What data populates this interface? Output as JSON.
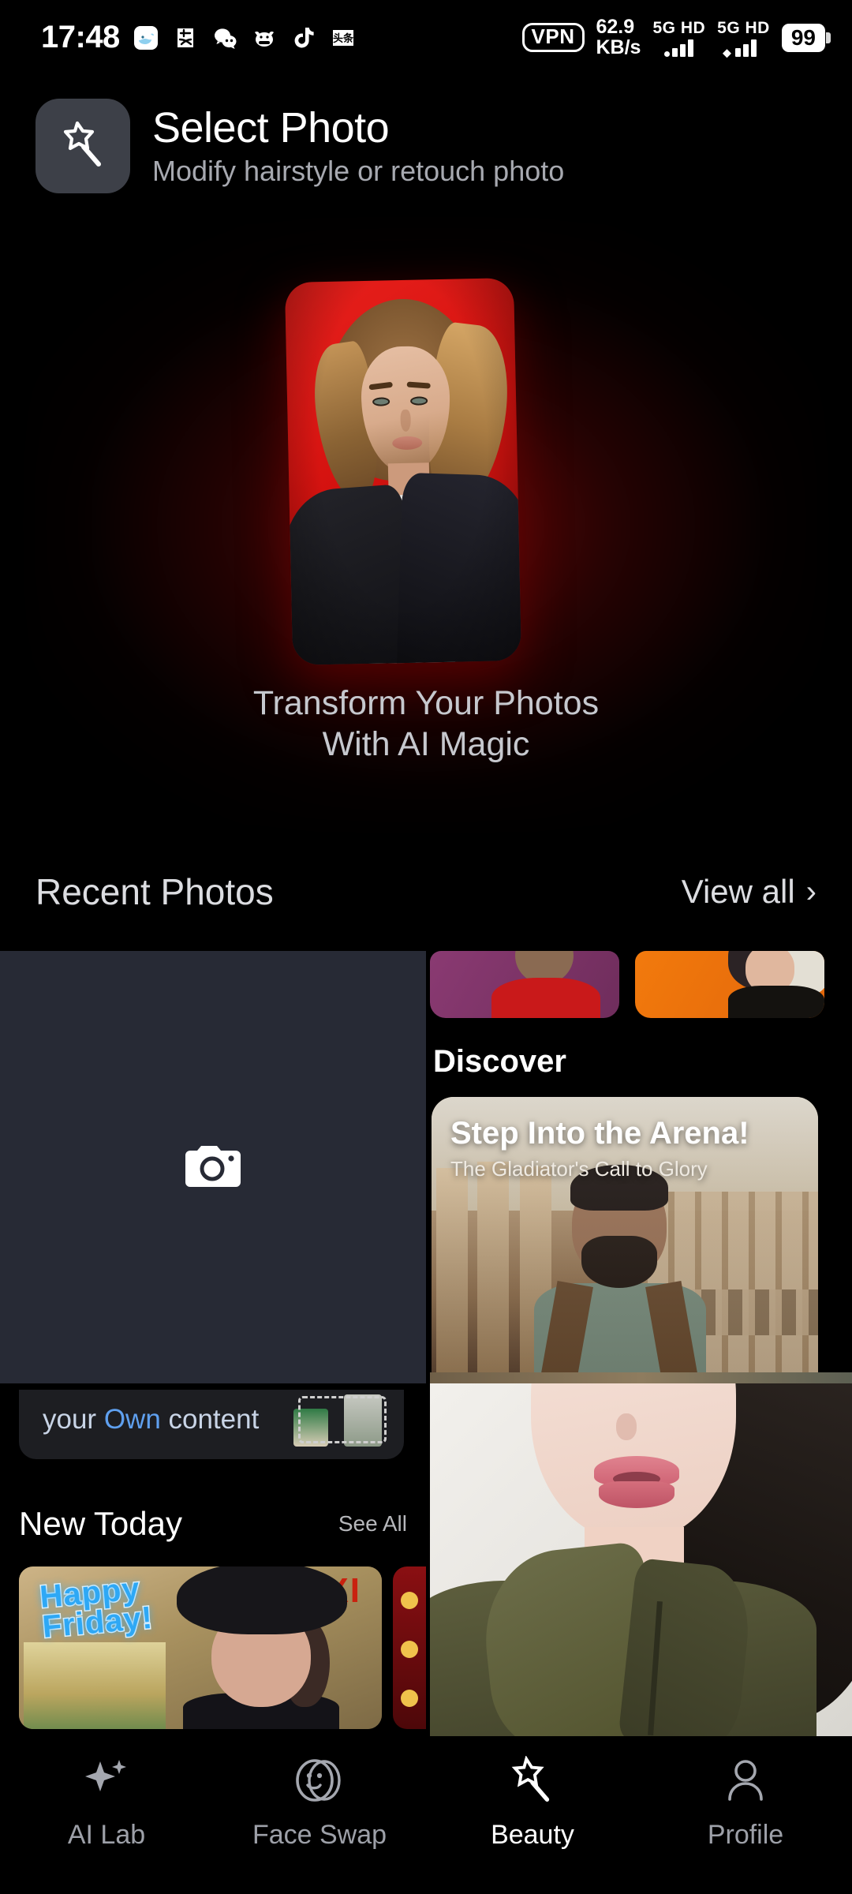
{
  "status_bar": {
    "time": "17:48",
    "tray_icons": [
      "whale-icon",
      "alipay-icon",
      "wechat-icon",
      "bull-icon",
      "tiktok-icon",
      "toutiao-icon"
    ],
    "vpn_label": "VPN",
    "net_speed_value": "62.9",
    "net_speed_unit": "KB/s",
    "sim1_label": "5G HD",
    "sim2_label": "5G HD",
    "battery_level": "99"
  },
  "header": {
    "icon": "magic-wand-icon",
    "title": "Select Photo",
    "subtitle": "Modify hairstyle or retouch photo",
    "icon_bg": "#3d4048"
  },
  "hero": {
    "caption_line1": "Transform Your Photos",
    "caption_line2": "With AI Magic",
    "card_bg_color": "#d4120f",
    "glow_color": "#aa0c0c",
    "caption_color": "#c6c8ce"
  },
  "recent_photos": {
    "title": "Recent Photos",
    "view_all_label": "View all",
    "chevron": "chevron-right-icon",
    "camera_tile": {
      "icon": "camera-icon",
      "bg_color": "#272a35"
    },
    "thumbnails": [
      {
        "name": "child-purple-thumb",
        "bg_color": "#6f2d5c"
      },
      {
        "name": "portrait-orange-thumb",
        "bg_color": "#e2660a"
      }
    ]
  },
  "discover": {
    "title": "Discover",
    "card": {
      "headline": "Step Into the Arena!",
      "subhead": "The Gladiator's Call to Glory"
    }
  },
  "own_content_band": {
    "text_prefix": "your ",
    "text_highlight": "Own",
    "text_suffix": " content",
    "highlight_color": "#5fa0ef",
    "bg_color": "#1d1e22"
  },
  "new_today": {
    "title": "New Today",
    "see_all_label": "See All",
    "cards": [
      {
        "name": "happy-friday-card",
        "sticker_line1": "Happy",
        "sticker_line2": "Friday!",
        "exit_sign": "EXI",
        "sticker_color": "#2ea8f5"
      },
      {
        "name": "red-stage-card",
        "sticker_line1": "",
        "sticker_line2": ""
      }
    ]
  },
  "bottom_nav": {
    "items": [
      {
        "label": "AI Lab",
        "icon": "sparkle-icon",
        "active": false
      },
      {
        "label": "Face Swap",
        "icon": "smiley-swap-icon",
        "active": false
      },
      {
        "label": "Beauty",
        "icon": "magic-wand-icon",
        "active": true
      },
      {
        "label": "Profile",
        "icon": "person-icon",
        "active": false
      }
    ],
    "active_color": "#ffffff",
    "inactive_color": "#9da0a8"
  }
}
